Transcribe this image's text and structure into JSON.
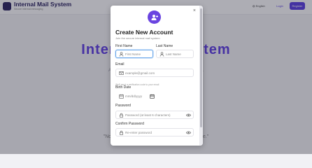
{
  "background": {
    "app_title": "Internal Mail System",
    "app_subtitle": "Secure internal messaging",
    "nav": {
      "english": "English",
      "login": "Login",
      "register": "Register"
    },
    "hero_title": "Internal Mail System",
    "hero_subtitle": "A secure internal mail system for your organization.",
    "quote": "\"No good can come from meaningless violence.\""
  },
  "modal": {
    "title": "Create New Account",
    "subtitle": "Join the secure internal mail system",
    "close_symbol": "×",
    "fields": {
      "first_name": {
        "label": "First Name",
        "placeholder": "First Name",
        "icon": "person-icon"
      },
      "last_name": {
        "label": "Last Name",
        "placeholder": "Last Name",
        "icon": "person-icon"
      },
      "email": {
        "label": "Email",
        "placeholder": "example@gmail.com",
        "hint": "We'll send a verification code to your email",
        "icon": "mail-icon"
      },
      "birth_date": {
        "label": "Birth Date",
        "placeholder": "mm/dd/yyyy",
        "icon": "calendar-icon"
      },
      "password": {
        "label": "Password",
        "placeholder": "Password (at least 6 characters)",
        "icon": "lock-icon"
      },
      "confirm_password": {
        "label": "Confirm Password",
        "placeholder": "Re-enter password",
        "icon": "lock-icon"
      }
    }
  },
  "colors": {
    "accent": "#6a44e0",
    "focus_border": "#6aa7e9"
  }
}
